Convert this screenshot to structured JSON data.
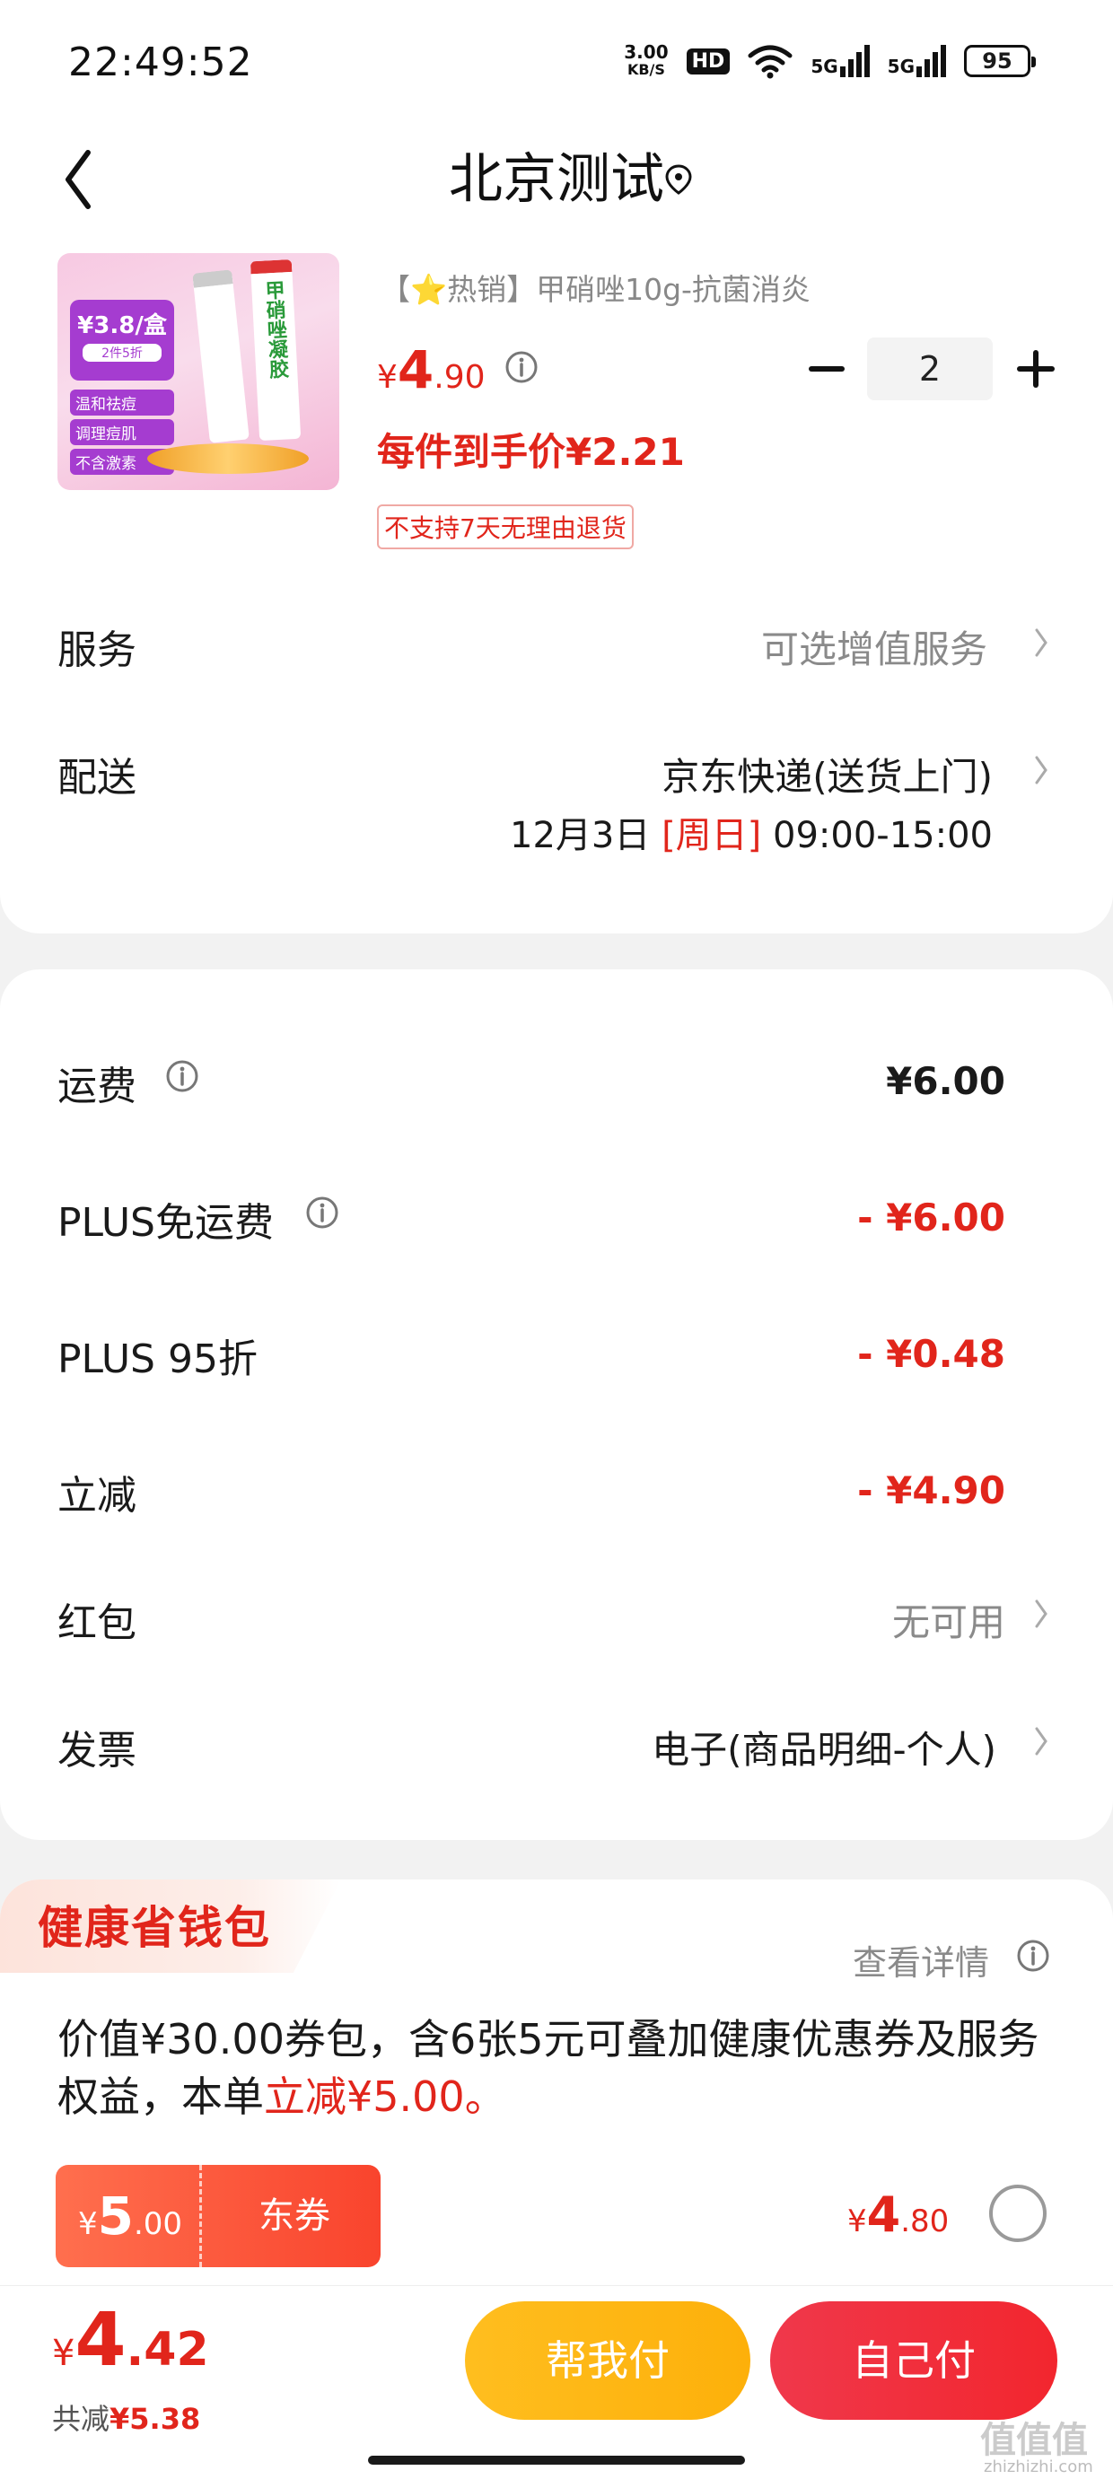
{
  "status_bar": {
    "time": "22:49:52",
    "net_speed_value": "3.00",
    "net_speed_unit": "KB/S",
    "hd_label": "HD",
    "signal1_label": "5G",
    "signal2_label": "5G",
    "battery": "95"
  },
  "header": {
    "title": "北京测试",
    "back_icon": "chevron-left-icon",
    "location_icon": "location-pin-icon"
  },
  "product": {
    "subtitle": "【⭐热销】甲硝唑10g-抗菌消炎",
    "price_currency": "¥",
    "price_integer": "4",
    "price_decimal": ".90",
    "quantity": "2",
    "unit_price": "每件到手价¥2.21",
    "return_policy": "不支持7天无理由退货",
    "image": {
      "badge_price": "¥3.8/盒",
      "badge_sub": "2件5折",
      "features": [
        "温和祛痘",
        "调理痘肌",
        "不含激素"
      ],
      "tube_text": "甲硝唑凝胶"
    }
  },
  "service": {
    "label": "服务",
    "value": "可选增值服务"
  },
  "delivery": {
    "label": "配送",
    "carrier": "京东快递(送货上门)",
    "date": "12月3日",
    "weekday": "[周日]",
    "time": "09:00-15:00"
  },
  "fees": {
    "shipping": {
      "label": "运费",
      "value": "¥6.00"
    },
    "plus_free_shipping": {
      "label": "PLUS免运费",
      "value": "- ¥6.00"
    },
    "plus_discount": {
      "label": "PLUS 95折",
      "value": "- ¥0.48"
    },
    "instant_discount": {
      "label": "立减",
      "value": "- ¥4.90"
    },
    "red_packet": {
      "label": "红包",
      "value": "无可用"
    },
    "invoice": {
      "label": "发票",
      "value": "电子(商品明细-个人)"
    }
  },
  "wallet": {
    "title": "健康省钱包",
    "detail_link": "查看详情",
    "desc_part1": "价值¥30.00券包，含6张5元可叠加健康优惠券及服务权益，本单",
    "desc_highlight": "立减¥5.00。",
    "coupon_currency": "¥",
    "coupon_integer": "5",
    "coupon_decimal": ".00",
    "coupon_label": "东券",
    "price_currency": "¥",
    "price_integer": "4",
    "price_decimal": ".80",
    "selected": false
  },
  "footer": {
    "total_currency": "¥",
    "total_integer": "4",
    "total_decimal": ".42",
    "saved_label": "共减",
    "saved_value": "¥5.38",
    "help_pay_label": "帮我付",
    "self_pay_label": "自己付"
  },
  "watermark": {
    "main": "值值值",
    "sub": "zhizhizhi.com"
  },
  "colors": {
    "accent_red": "#e1251b",
    "help_pay_yellow": "#ffbe1f",
    "self_pay_red": "#f0384b"
  }
}
